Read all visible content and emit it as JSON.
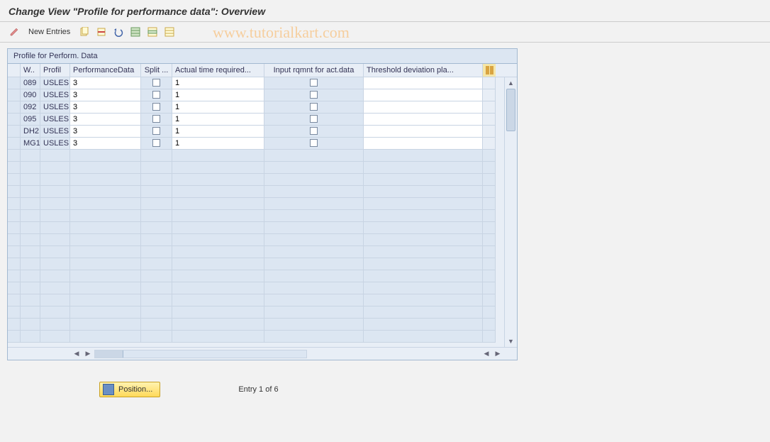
{
  "title": "Change View \"Profile for performance data\": Overview",
  "toolbar": {
    "change_icon": "change",
    "new_entries_label": "New Entries",
    "copy_icon": "copy",
    "delete_icon": "delete",
    "undo_icon": "undo",
    "select_all_icon": "select-all",
    "select_block_icon": "select-block",
    "deselect_all_icon": "deselect-all"
  },
  "watermark": "www.tutorialkart.com",
  "grid": {
    "title": "Profile for Perform. Data",
    "columns": {
      "who": "W..",
      "profil": "Profil",
      "perf_data": "PerformanceData",
      "split": "Split ...",
      "actual": "Actual time required...",
      "input_rq": "Input rqmnt for act.data",
      "threshold": "Threshold deviation pla..."
    },
    "rows": [
      {
        "who": "089",
        "profil": "USLES",
        "perf": "3",
        "split": false,
        "actual": "1",
        "input": false,
        "threshold": ""
      },
      {
        "who": "090",
        "profil": "USLES",
        "perf": "3",
        "split": false,
        "actual": "1",
        "input": false,
        "threshold": ""
      },
      {
        "who": "092",
        "profil": "USLES",
        "perf": "3",
        "split": false,
        "actual": "1",
        "input": false,
        "threshold": ""
      },
      {
        "who": "095",
        "profil": "USLES",
        "perf": "3",
        "split": false,
        "actual": "1",
        "input": false,
        "threshold": ""
      },
      {
        "who": "DH2",
        "profil": "USLES",
        "perf": "3",
        "split": false,
        "actual": "1",
        "input": false,
        "threshold": ""
      },
      {
        "who": "MG1",
        "profil": "USLES",
        "perf": "3",
        "split": false,
        "actual": "1",
        "input": false,
        "threshold": ""
      }
    ],
    "empty_rows": 16
  },
  "footer": {
    "position_label": "Position...",
    "entry_label": "Entry 1 of 6"
  }
}
